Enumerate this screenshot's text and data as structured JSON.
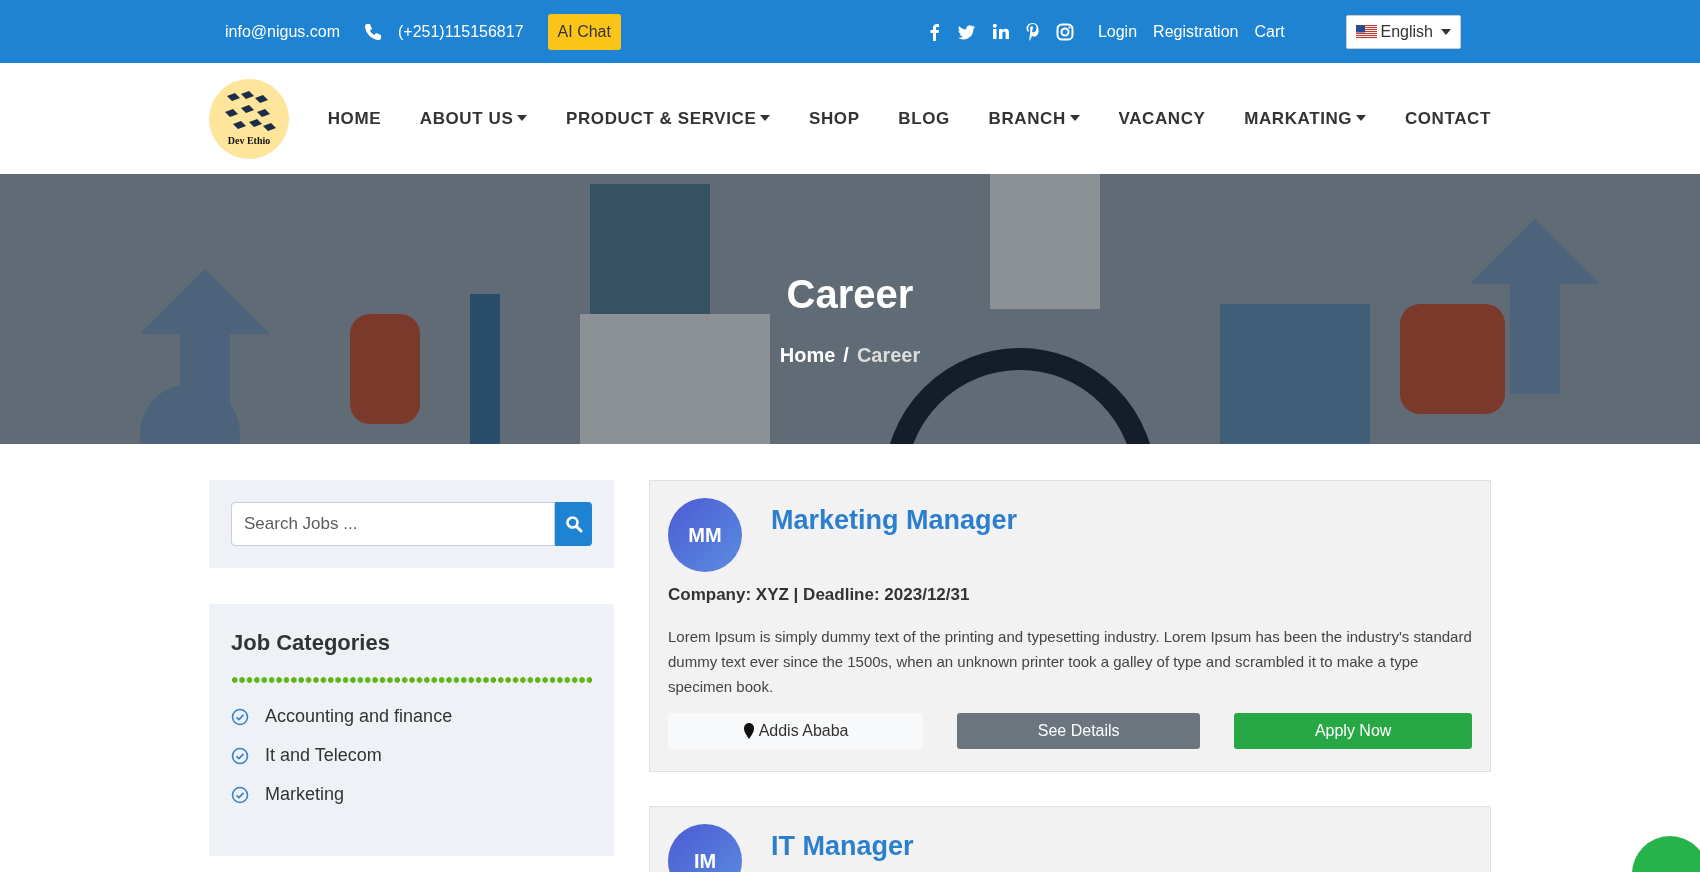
{
  "topbar": {
    "email": "info@nigus.com",
    "phone": "(+251)115156817",
    "ai_chat": "AI Chat",
    "links": [
      "Login",
      "Registration",
      "Cart"
    ],
    "language": "English"
  },
  "logo": {
    "text": "Dev Ethio"
  },
  "nav": [
    {
      "label": "HOME",
      "dropdown": false
    },
    {
      "label": "ABOUT US",
      "dropdown": true
    },
    {
      "label": "PRODUCT & SERVICE",
      "dropdown": true
    },
    {
      "label": "SHOP",
      "dropdown": false
    },
    {
      "label": "BLOG",
      "dropdown": false
    },
    {
      "label": "BRANCH",
      "dropdown": true
    },
    {
      "label": "VACANCY",
      "dropdown": false
    },
    {
      "label": "MARKATING",
      "dropdown": true
    },
    {
      "label": "CONTACT",
      "dropdown": false
    }
  ],
  "hero": {
    "title": "Career",
    "separator": "/",
    "breadcrumb": [
      {
        "label": "Home",
        "selected": false
      },
      {
        "label": "Career",
        "selected": true
      }
    ]
  },
  "search": {
    "placeholder": "Search Jobs ..."
  },
  "categories": {
    "title": "Job Categories",
    "items": [
      "Accounting and finance",
      "It and Telecom",
      "Marketing"
    ]
  },
  "jobs": [
    {
      "initials": "MM",
      "title": "Marketing Manager",
      "meta": "Company: XYZ | Deadline: 2023/12/31",
      "description": "Lorem Ipsum is simply dummy text of the printing and typesetting industry. Lorem Ipsum has been the industry's standard dummy text ever since the 1500s, when an unknown printer took a galley of type and scrambled it to make a type specimen book.",
      "location": "Addis Ababa",
      "details_button": "See Details",
      "apply_button": "Apply Now"
    },
    {
      "initials": "IM",
      "title": "IT Manager"
    }
  ]
}
